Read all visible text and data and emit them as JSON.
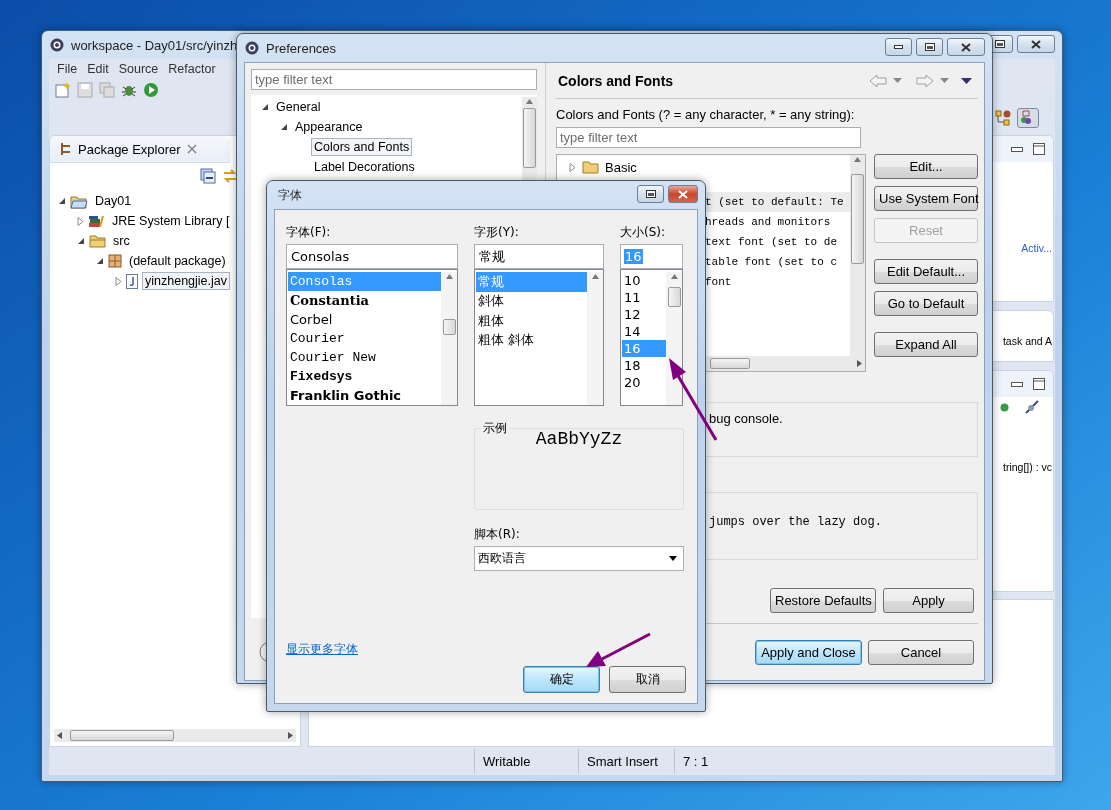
{
  "eclipse": {
    "title": "workspace - Day01/src/yinzh",
    "menu": [
      "File",
      "Edit",
      "Source",
      "Refactor"
    ],
    "package_explorer": {
      "title": "Package Explorer",
      "tree": [
        {
          "label": "Day01",
          "kind": "project",
          "expanded": true,
          "selected": false,
          "children": [
            {
              "label": "JRE System Library [",
              "kind": "library",
              "expanded": false,
              "selected": false
            },
            {
              "label": "src",
              "kind": "folder",
              "expanded": true,
              "selected": false,
              "children": [
                {
                  "label": "(default package)",
                  "kind": "package",
                  "expanded": true,
                  "selected": false,
                  "children": [
                    {
                      "label": "yinzhengjie.jav",
                      "kind": "file",
                      "expanded": false,
                      "selected": true
                    }
                  ]
                }
              ]
            }
          ]
        }
      ]
    },
    "side_texts": [
      {
        "text": "Activ...",
        "kind": "link"
      },
      {
        "text": "task and A",
        "kind": "plain"
      },
      {
        "text": "tring[]) : vc",
        "kind": "code"
      }
    ],
    "status_bar": [
      "Writable",
      "Smart Insert",
      "7 : 1"
    ]
  },
  "preferences": {
    "title": "Preferences",
    "filter": {
      "placeholder": "type filter text"
    },
    "tree": [
      {
        "label": "General",
        "expanded": true,
        "selected": false,
        "children": [
          {
            "label": "Appearance",
            "expanded": true,
            "selected": false,
            "children": [
              {
                "label": "Colors and Fonts",
                "selected": true
              },
              {
                "label": "Label Decorations",
                "selected": false
              }
            ]
          }
        ]
      }
    ],
    "page_title": "Colors and Fonts",
    "filter_label": "Colors and Fonts (? = any character, * = any string):",
    "page_filter": {
      "placeholder": "type filter text"
    },
    "items": [
      {
        "label": "Basic",
        "kind": "category",
        "selected": false
      },
      {
        "label": "t (set to default: Te",
        "kind": "font",
        "selected": true
      },
      {
        "label": "hreads and monitors",
        "kind": "font",
        "selected": false
      },
      {
        "label": "text font (set to de",
        "kind": "font",
        "selected": false
      },
      {
        "label": "table font (set to c",
        "kind": "font",
        "selected": false
      },
      {
        "label": "font",
        "kind": "font",
        "selected": false
      }
    ],
    "buttons": [
      {
        "label": "Edit...",
        "disabled": false
      },
      {
        "label": "Use System Font",
        "disabled": false
      },
      {
        "label": "Reset",
        "disabled": true
      },
      {
        "label": "Edit Default...",
        "disabled": false
      },
      {
        "label": "Go to Default",
        "disabled": false
      },
      {
        "label": "Expand All",
        "disabled": false
      }
    ],
    "description": "bug console.",
    "preview": "jumps over the lazy dog.",
    "footer_buttons": [
      "Restore Defaults",
      "Apply"
    ],
    "dialog_buttons": [
      {
        "label": "Apply and Close",
        "default": true
      },
      {
        "label": "Cancel",
        "default": false
      }
    ]
  },
  "font_dialog": {
    "title": "字体",
    "font": {
      "label": "字体(F):",
      "value": "Consolas",
      "options": [
        {
          "label": "Consolas",
          "kind": "mono",
          "selected": true
        },
        {
          "label": "Constantia",
          "kind": "serif",
          "selected": false
        },
        {
          "label": "Corbel",
          "kind": "sans",
          "selected": false
        },
        {
          "label": "Courier",
          "kind": "mono",
          "selected": false
        },
        {
          "label": "Courier New",
          "kind": "mono",
          "selected": false
        },
        {
          "label": "Fixedsys",
          "kind": "boldmono",
          "selected": false
        },
        {
          "label": "Franklin Gothic",
          "kind": "boldsans",
          "selected": false
        }
      ]
    },
    "style": {
      "label": "字形(Y):",
      "value": "常规",
      "options": [
        {
          "label": "常规",
          "selected": true
        },
        {
          "label": "斜体",
          "selected": false
        },
        {
          "label": "粗体",
          "selected": false
        },
        {
          "label": "粗体 斜体",
          "selected": false
        }
      ]
    },
    "size": {
      "label": "大小(S):",
      "value": "16",
      "options": [
        {
          "label": "10",
          "selected": false
        },
        {
          "label": "11",
          "selected": false
        },
        {
          "label": "12",
          "selected": false
        },
        {
          "label": "14",
          "selected": false
        },
        {
          "label": "16",
          "selected": true
        },
        {
          "label": "18",
          "selected": false
        },
        {
          "label": "20",
          "selected": false
        }
      ]
    },
    "sample": {
      "label": "示例",
      "text": "AaBbYyZz"
    },
    "script": {
      "label": "脚本(R):",
      "value": "西欧语言"
    },
    "more_link": "显示更多字体",
    "buttons": [
      {
        "label": "确定",
        "default": true
      },
      {
        "label": "取消",
        "default": false
      }
    ]
  }
}
